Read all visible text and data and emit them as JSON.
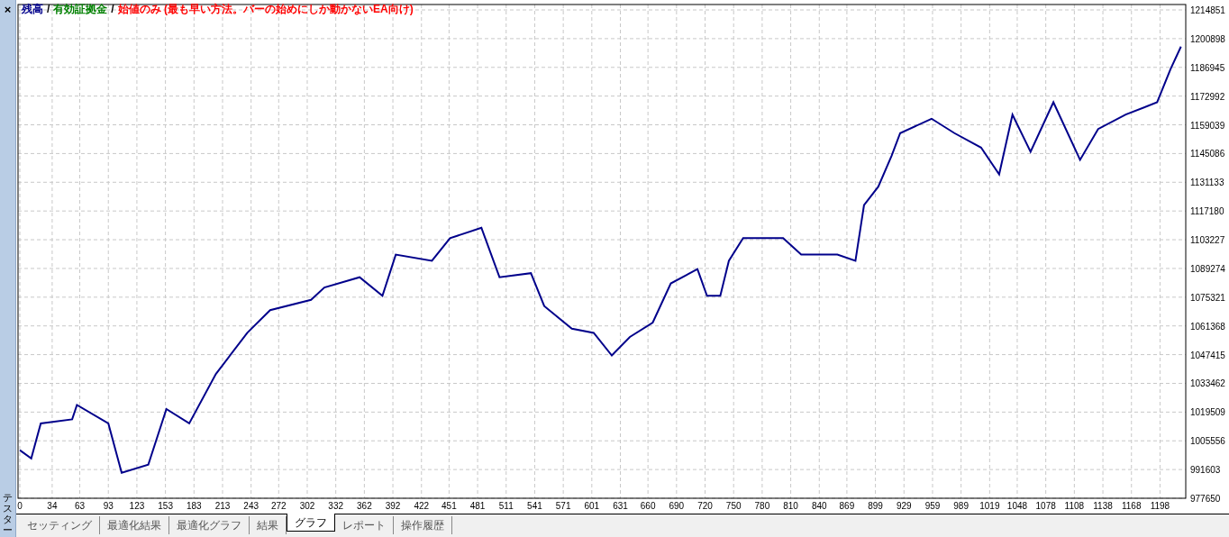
{
  "side_panel": {
    "close": "×",
    "title": "テスター"
  },
  "chart": {
    "legend": [
      {
        "label": "有効証拠金",
        "color": "#008000"
      },
      {
        "label": "始値のみ (最も早い方法。バーの始めにしか動かないEA向け)",
        "color": "#ff0000"
      }
    ],
    "legend_separator": "/",
    "chart_data": {
      "type": "line",
      "grid": true,
      "xlim": [
        0,
        1226
      ],
      "ylim": [
        977650,
        1214851
      ],
      "xticks": [
        0,
        34,
        63,
        93,
        123,
        153,
        183,
        213,
        243,
        272,
        302,
        332,
        362,
        392,
        422,
        451,
        481,
        511,
        541,
        571,
        601,
        631,
        660,
        690,
        720,
        750,
        780,
        810,
        840,
        869,
        899,
        929,
        959,
        989,
        1019,
        1048,
        1078,
        1108,
        1138,
        1168,
        1198
      ],
      "yticks": [
        977650,
        991603,
        1005556,
        1019509,
        1033462,
        1047415,
        1061368,
        1075321,
        1089274,
        1103227,
        1117180,
        1131133,
        1145086,
        1159039,
        1172992,
        1186945,
        1200898,
        1214851
      ],
      "x": [
        0,
        12,
        22,
        55,
        60,
        93,
        107,
        135,
        154,
        178,
        206,
        239,
        263,
        306,
        320,
        357,
        381,
        395,
        433,
        452,
        485,
        504,
        537,
        551,
        580,
        603,
        622,
        641,
        665,
        684,
        712,
        722,
        736,
        745,
        760,
        802,
        821,
        859,
        878,
        887,
        902,
        916,
        925,
        958,
        982,
        1010,
        1029,
        1043,
        1062,
        1086,
        1114,
        1133,
        1162,
        1195,
        1209,
        1220
      ],
      "series": [
        {
          "name": "残高",
          "color": "#00008b",
          "values": [
            1001000,
            997000,
            1014000,
            1016000,
            1023000,
            1014000,
            990000,
            994000,
            1021000,
            1014000,
            1038000,
            1058000,
            1069000,
            1074000,
            1080000,
            1085000,
            1076000,
            1096000,
            1093000,
            1104000,
            1109000,
            1085000,
            1087000,
            1071000,
            1060000,
            1058000,
            1047000,
            1056000,
            1063000,
            1082000,
            1089000,
            1076000,
            1076000,
            1093000,
            1104000,
            1104000,
            1096000,
            1096000,
            1093000,
            1120000,
            1129000,
            1144000,
            1155000,
            1162000,
            1155000,
            1148000,
            1135000,
            1164000,
            1146000,
            1170000,
            1142000,
            1157000,
            1164000,
            1170000,
            1186000,
            1197000
          ]
        }
      ]
    }
  },
  "tabs": [
    {
      "label": "セッティング",
      "selected": false
    },
    {
      "label": "最適化結果",
      "selected": false
    },
    {
      "label": "最適化グラフ",
      "selected": false
    },
    {
      "label": "結果",
      "selected": false
    },
    {
      "label": "グラフ",
      "selected": true
    },
    {
      "label": "レポート",
      "selected": false
    },
    {
      "label": "操作履歴",
      "selected": false
    }
  ]
}
